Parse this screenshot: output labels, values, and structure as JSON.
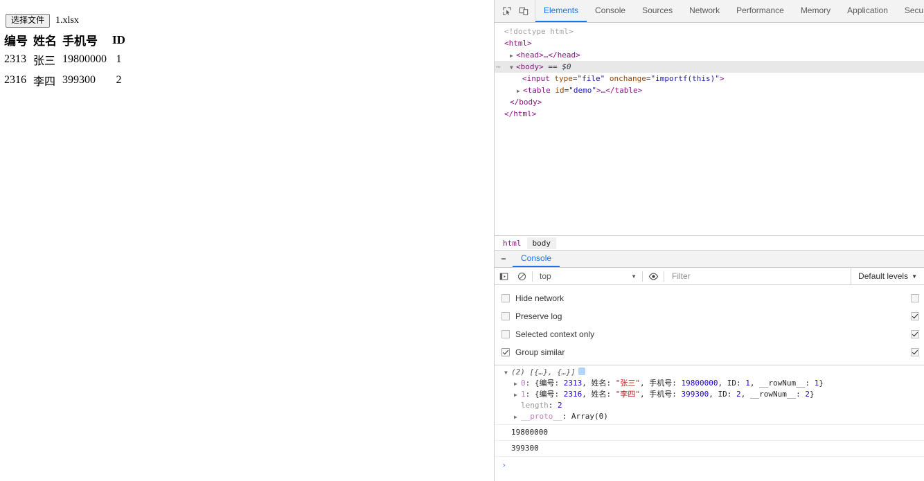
{
  "page": {
    "file_input": {
      "button_label": "选择文件",
      "file_name": "1.xlsx"
    },
    "table": {
      "headers": [
        "编号",
        "姓名",
        "手机号",
        "ID"
      ],
      "rows": [
        [
          "2313",
          "张三",
          "19800000",
          "1"
        ],
        [
          "2316",
          "李四",
          "399300",
          "2"
        ]
      ]
    }
  },
  "devtools": {
    "toolbar_icons": [
      "inspect-element-icon",
      "device-toolbar-icon"
    ],
    "tabs": [
      {
        "label": "Elements",
        "active": true
      },
      {
        "label": "Console",
        "active": false
      },
      {
        "label": "Sources",
        "active": false
      },
      {
        "label": "Network",
        "active": false
      },
      {
        "label": "Performance",
        "active": false
      },
      {
        "label": "Memory",
        "active": false
      },
      {
        "label": "Application",
        "active": false
      },
      {
        "label": "Secu",
        "active": false
      }
    ],
    "dom_tree": {
      "doctype": "<!doctype html>",
      "html_open": "<html>",
      "head_collapsed": "<head>…</head>",
      "body_open": "<body>",
      "body_marker": "== $0",
      "input_line": "<input type=\"file\" onchange=\"importf(this)\">",
      "input_tag": "input",
      "input_attr1_name": "type",
      "input_attr1_value": "\"file\"",
      "input_attr2_name": "onchange",
      "input_attr2_value": "\"importf(this)\"",
      "table_collapsed": "<table id=\"demo\">…</table>",
      "table_tag": "table",
      "table_attr_name": "id",
      "table_attr_value": "\"demo\"",
      "body_close": "</body>",
      "html_close": "</html>"
    },
    "breadcrumb": [
      "html",
      "body"
    ],
    "drawer": {
      "tab_label": "Console",
      "filter_bar": {
        "context_value": "top",
        "filter_placeholder": "Filter",
        "levels_label": "Default levels"
      },
      "settings": [
        {
          "label": "Hide network",
          "checked": false,
          "right_checked": false
        },
        {
          "label": "Preserve log",
          "checked": false,
          "right_checked": true
        },
        {
          "label": "Selected context only",
          "checked": false,
          "right_checked": true
        },
        {
          "label": "Group similar",
          "checked": true,
          "right_checked": true
        }
      ],
      "messages": {
        "array_header": "(2) [{…}, {…}]",
        "array_count": "(2)",
        "array_preview": "[{…}, {…}]",
        "entries": [
          {
            "index": "0",
            "编号": "2313",
            "姓名": "\"张三\"",
            "手机号": "19800000",
            "ID": "1",
            "__rowNum__": "1"
          },
          {
            "index": "1",
            "编号": "2316",
            "姓名": "\"李四\"",
            "手机号": "399300",
            "ID": "2",
            "__rowNum__": "2"
          }
        ],
        "length_key": "length",
        "length_value": "2",
        "proto_key": "__proto__",
        "proto_value": "Array(0)",
        "logs": [
          "19800000",
          "399300"
        ]
      },
      "prompt_symbol": "›"
    }
  },
  "colors": {
    "accent": "#1a73e8",
    "tag": "#881280",
    "attr_name": "#994500",
    "attr_value": "#1a1aa6",
    "js_string": "#c41a16",
    "js_number": "#1c00cf",
    "panel_bg": "#f3f3f3"
  }
}
